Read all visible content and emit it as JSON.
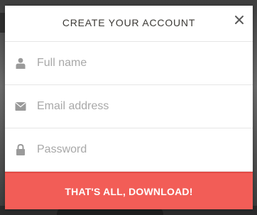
{
  "modal": {
    "title": "CREATE YOUR ACCOUNT",
    "close_icon": "close-icon"
  },
  "form": {
    "fields": [
      {
        "icon": "user-icon",
        "placeholder": "Full name",
        "value": ""
      },
      {
        "icon": "envelope-icon",
        "placeholder": "Email address",
        "value": ""
      },
      {
        "icon": "lock-icon",
        "placeholder": "Password",
        "value": ""
      }
    ],
    "submit_label": "THAT'S ALL, DOWNLOAD!"
  },
  "colors": {
    "accent": "#f25d57",
    "icon": "#9a9a9a",
    "title": "#3c3a36",
    "placeholder": "#a8a8a8"
  }
}
